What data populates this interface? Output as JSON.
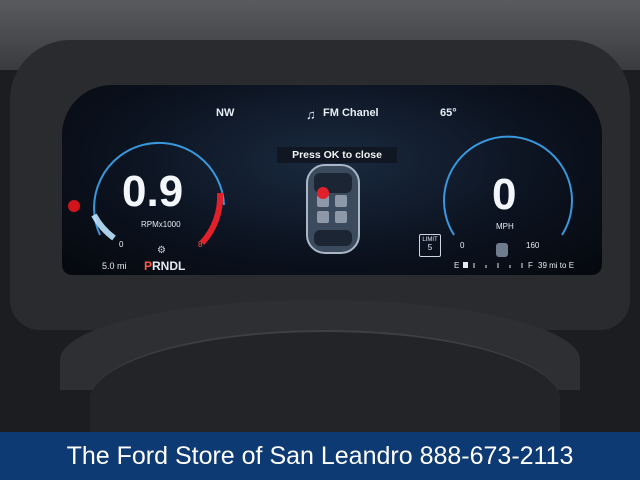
{
  "header": {
    "heading": "NW",
    "media_icon": "music-note-icon",
    "media_label": "FM Chanel",
    "temperature": "65°"
  },
  "notice": {
    "message": "Press OK to close"
  },
  "tach": {
    "value": "0.9",
    "unit": "RPMx1000",
    "scale_min": "0",
    "scale_max": "8",
    "odometer": "5.0",
    "odometer_unit": "mi"
  },
  "gear": {
    "selected": "P",
    "others": "RNDL",
    "icon": "gear-shifter-icon"
  },
  "speed": {
    "value": "0",
    "unit": "MPH",
    "scale_min": "0",
    "scale_max": "160"
  },
  "speed_limit": {
    "label": "LIMIT",
    "value": "5"
  },
  "fuel": {
    "empty": "E",
    "full": "F",
    "range": "39",
    "range_unit": "mi to E",
    "icon": "fuel-pump-icon"
  },
  "dealer_banner": {
    "name": "The Ford Store of San Leandro",
    "phone": "888-673-2113"
  },
  "colors": {
    "accent_blue": "#3ea6f2",
    "redline": "#e0202a",
    "gear_selected": "#ff5a3c",
    "banner_bg": "#0d3a73"
  }
}
